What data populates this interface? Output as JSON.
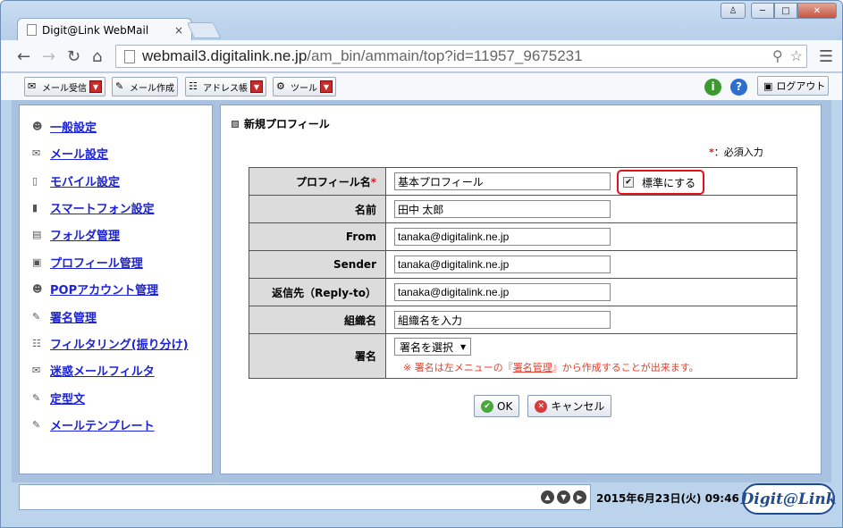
{
  "browser": {
    "tab_title": "Digit@Link WebMail",
    "tab_close": "×",
    "url_host": "webmail3.digitalink.ne.jp",
    "url_path": "/am_bin/ammain/top?id=11957_9675231"
  },
  "app_toolbar": {
    "mail_receive": "メール受信",
    "mail_compose": "メール作成",
    "address_book": "アドレス帳",
    "tools": "ツール",
    "logout": "ログアウト"
  },
  "sidebar": {
    "items": [
      {
        "label": "一般設定",
        "icon": "user-icon"
      },
      {
        "label": "メール設定",
        "icon": "mail-settings-icon"
      },
      {
        "label": "モバイル設定",
        "icon": "mobile-icon"
      },
      {
        "label": "スマートフォン設定",
        "icon": "smartphone-icon"
      },
      {
        "label": "フォルダ管理",
        "icon": "folder-icon"
      },
      {
        "label": "プロフィール管理",
        "icon": "profile-icon"
      },
      {
        "label": "POPアカウント管理",
        "icon": "pop-account-icon"
      },
      {
        "label": "署名管理",
        "icon": "signature-icon"
      },
      {
        "label": "フィルタリング(振り分け)",
        "icon": "filter-icon"
      },
      {
        "label": "迷惑メールフィルタ",
        "icon": "spam-filter-icon"
      },
      {
        "label": "定型文",
        "icon": "template-text-icon"
      },
      {
        "label": "メールテンプレート",
        "icon": "mail-template-icon"
      }
    ]
  },
  "main": {
    "section_title": "新規プロフィール",
    "required_mark": "*",
    "required_note": "：必須入力",
    "form": {
      "profile_name_label": "プロフィール名",
      "profile_name_value": "基本プロフィール",
      "default_checkbox_label": "標準にする",
      "default_checked": true,
      "name_label": "名前",
      "name_value": "田中 太郎",
      "from_label": "From",
      "from_value": "tanaka@digitalink.ne.jp",
      "sender_label": "Sender",
      "sender_value": "tanaka@digitalink.ne.jp",
      "reply_to_label": "返信先（Reply-to）",
      "reply_to_value": "tanaka@digitalink.ne.jp",
      "org_label": "組織名",
      "org_value": "組織名を入力",
      "signature_label": "署名",
      "signature_select": "署名を選択",
      "signature_note_pre": "※ 署名は左メニューの『",
      "signature_note_link": "署名管理",
      "signature_note_post": "』から作成することが出来ます。"
    },
    "ok_button": "OK",
    "cancel_button": "キャンセル"
  },
  "footer": {
    "datetime": "2015年6月23日(火) 09:46",
    "logo": "Digit@Link"
  }
}
